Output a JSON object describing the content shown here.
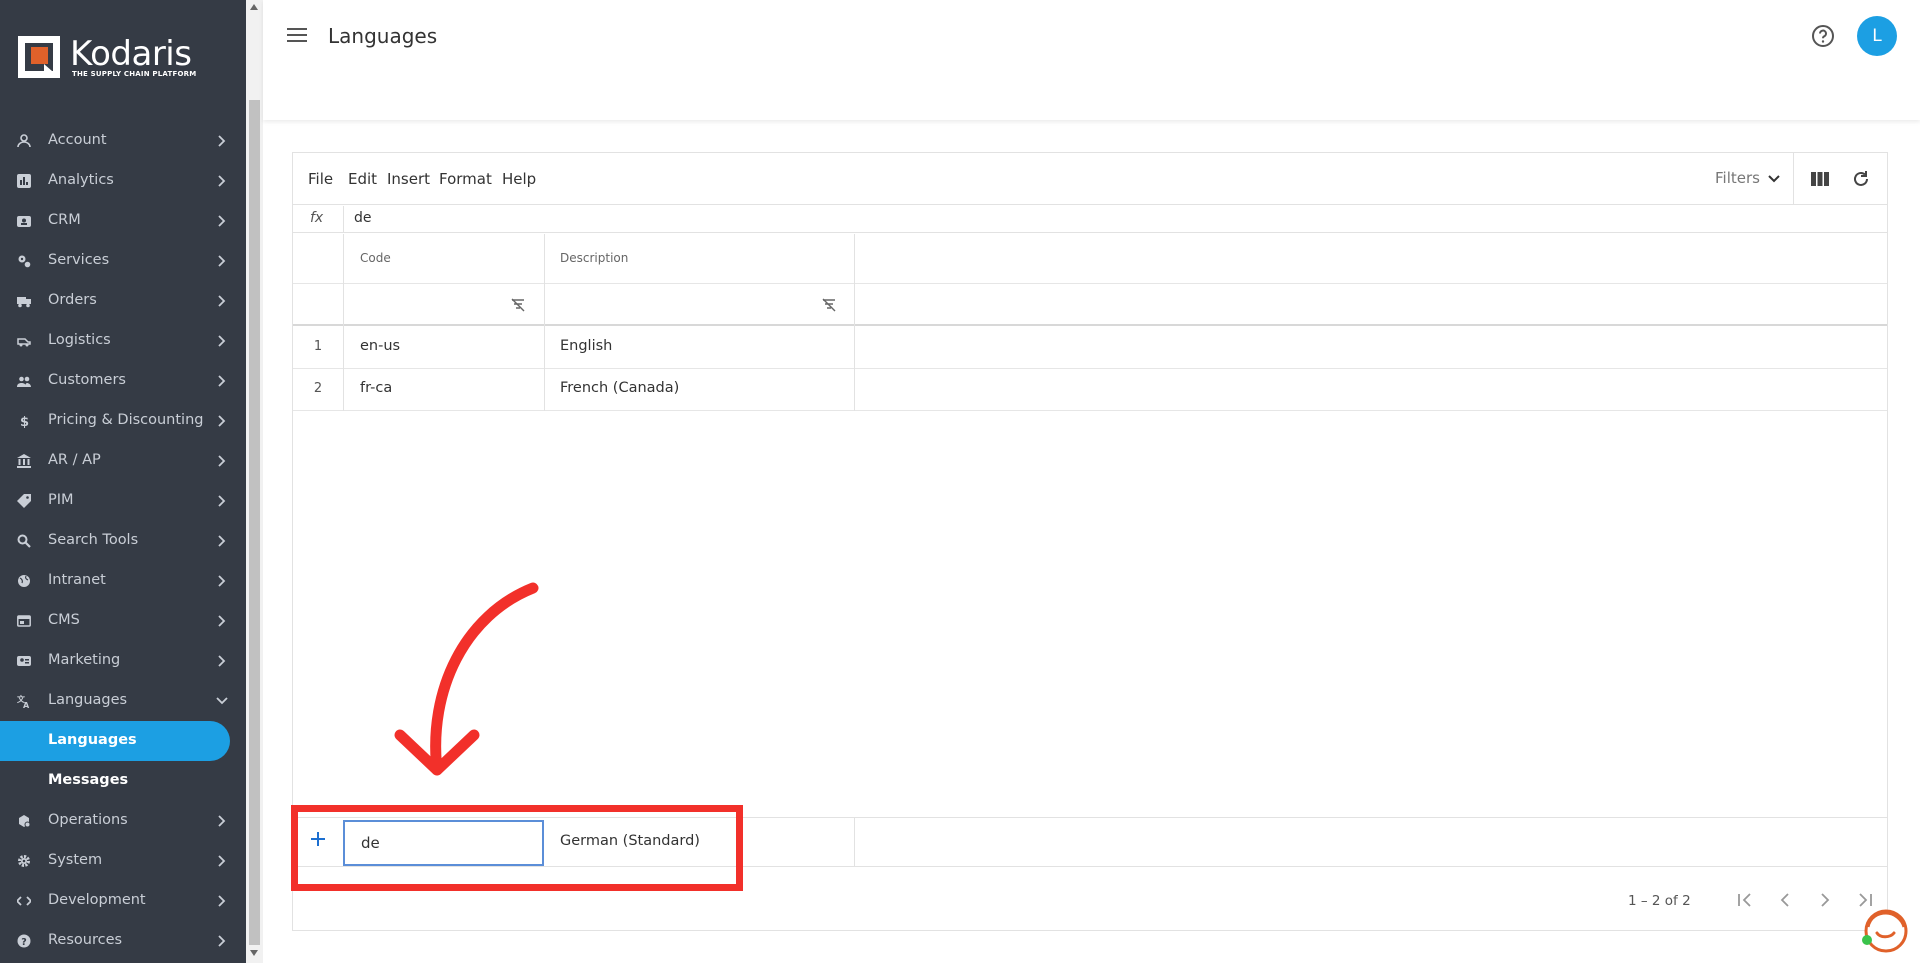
{
  "brand": {
    "name": "Kodaris",
    "tagline": "THE SUPPLY CHAIN PLATFORM"
  },
  "sidebar": {
    "items": [
      {
        "label": "Account",
        "icon": "person-icon"
      },
      {
        "label": "Analytics",
        "icon": "chart-icon"
      },
      {
        "label": "CRM",
        "icon": "contact-card-icon"
      },
      {
        "label": "Services",
        "icon": "gears-icon"
      },
      {
        "label": "Orders",
        "icon": "truck-icon"
      },
      {
        "label": "Logistics",
        "icon": "delivery-icon"
      },
      {
        "label": "Customers",
        "icon": "people-icon"
      },
      {
        "label": "Pricing & Discounting",
        "icon": "dollar-icon"
      },
      {
        "label": "AR / AP",
        "icon": "bank-icon"
      },
      {
        "label": "PIM",
        "icon": "tag-icon"
      },
      {
        "label": "Search Tools",
        "icon": "search-icon"
      },
      {
        "label": "Intranet",
        "icon": "globe-icon"
      },
      {
        "label": "CMS",
        "icon": "cms-icon"
      },
      {
        "label": "Marketing",
        "icon": "marketing-icon"
      },
      {
        "label": "Languages",
        "icon": "translate-icon"
      }
    ],
    "sub_items": [
      {
        "label": "Languages"
      },
      {
        "label": "Messages"
      }
    ],
    "items_after": [
      {
        "label": "Operations",
        "icon": "operations-icon"
      },
      {
        "label": "System",
        "icon": "gear-icon"
      },
      {
        "label": "Development",
        "icon": "code-icon"
      },
      {
        "label": "Resources",
        "icon": "help-circle-icon"
      }
    ]
  },
  "header": {
    "title": "Languages",
    "avatar_initial": "L"
  },
  "toolbar": {
    "menu": [
      "File",
      "Edit",
      "Insert",
      "Format",
      "Help"
    ],
    "filters_label": "Filters"
  },
  "formula_bar": {
    "label": "fx",
    "value": "de"
  },
  "grid": {
    "columns": [
      "Code",
      "Description"
    ],
    "rows": [
      {
        "num": "1",
        "code": "en-us",
        "description": "English"
      },
      {
        "num": "2",
        "code": "fr-ca",
        "description": "French (Canada)"
      }
    ],
    "new_row": {
      "code": "de",
      "description": "German (Standard)"
    },
    "pagination": "1 – 2 of 2"
  },
  "colors": {
    "sidebar_bg": "#353b45",
    "accent": "#1c9fe3",
    "annotation": "#f2302a"
  }
}
